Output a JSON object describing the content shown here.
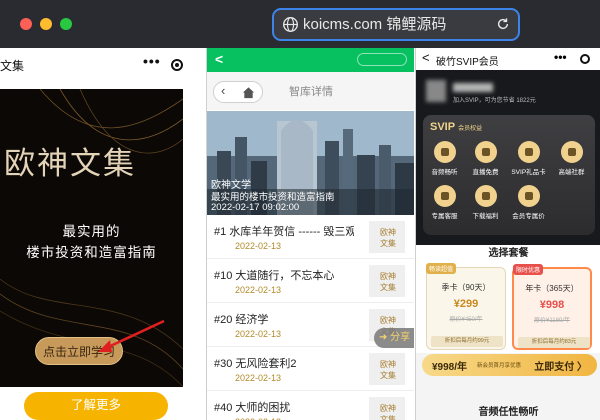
{
  "browser": {
    "url": "koicms.com 锦鲤源码",
    "icons": {
      "globe": "globe-icon",
      "reload": "reload-icon"
    }
  },
  "panel1": {
    "title": "文集",
    "more": "•••",
    "poster": {
      "title": "欧神文集",
      "subtitle_1": "最实用的",
      "subtitle_2": "楼市投资和造富指南",
      "cta": "点击立即学习"
    },
    "bottom_button": "了解更多"
  },
  "panel2": {
    "nav_title": "智库详情",
    "hero": {
      "line1": "欧神文学",
      "line2": "最实用的楼市投资和造富指南",
      "line3": "2022-02-17 09:02:00"
    },
    "thumb_text": [
      "欧神",
      "文集"
    ],
    "articles": [
      {
        "title": "#1 水库羊年贺信 ------ 毁三观...",
        "date": "2022-02-13"
      },
      {
        "title": "#10 大道随行，不忘本心",
        "date": "2022-02-13"
      },
      {
        "title": "#20 经济学",
        "date": "2022-02-13"
      },
      {
        "title": "#30 无风险套利2",
        "date": "2022-02-13"
      },
      {
        "title": "#40 大师的困扰",
        "date": "2022-02-13"
      }
    ],
    "share": "分享"
  },
  "panel3": {
    "title": "破竹SVIP会员",
    "more": "•••",
    "vip": {
      "status_line": "加入SVIP，可为您节省 1822元",
      "label": "SVIP",
      "label_sub": "会员权益",
      "benefits": [
        "音频畅听",
        "直播免费",
        "SVIP礼品卡",
        "高端社群",
        "专属客服",
        "下载福利",
        "会员专属价"
      ]
    },
    "choose_title": "选择套餐",
    "plans": [
      {
        "tag": "畅读超值",
        "name": "季卡（90天）",
        "price": "¥299",
        "orig": "原价¥450/年",
        "foot": "折扣后每月约99元"
      },
      {
        "tag": "限时优惠",
        "name": "年卡（365天）",
        "price": "¥998",
        "orig": "原价¥1180/年",
        "foot": "折扣后每月约83元"
      }
    ],
    "pay": {
      "amount": "¥998/年",
      "note": "新会员首月享优惠",
      "button": "立即支付 〉"
    },
    "audio_title": "音频任性畅听"
  },
  "colors": {
    "accent_blue": "#3c84e8",
    "wechat_green": "#07c160",
    "gold": "#c79a5c",
    "yellow_button": "#f6b400",
    "vip_orange": "#ff8a4c"
  }
}
